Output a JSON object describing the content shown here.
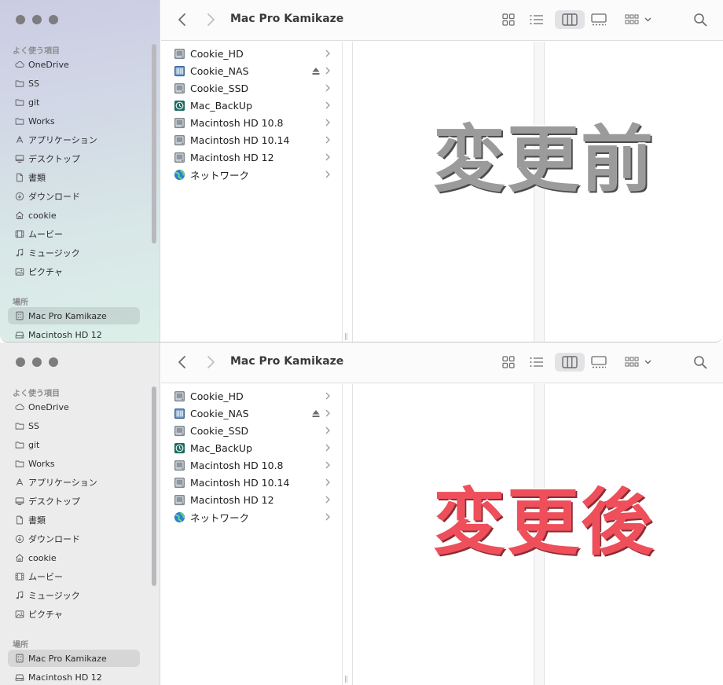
{
  "window_title": "Mac Pro Kamikaze",
  "sidebar": {
    "favorites_header": "よく使う項目",
    "locations_header": "場所",
    "favorites": [
      {
        "label": "OneDrive",
        "icon": "cloud-icon"
      },
      {
        "label": "SS",
        "icon": "folder-icon"
      },
      {
        "label": "git",
        "icon": "folder-icon"
      },
      {
        "label": "Works",
        "icon": "folder-icon"
      },
      {
        "label": "アプリケーション",
        "icon": "applications-icon"
      },
      {
        "label": "デスクトップ",
        "icon": "desktop-icon"
      },
      {
        "label": "書類",
        "icon": "document-icon"
      },
      {
        "label": "ダウンロード",
        "icon": "download-icon"
      },
      {
        "label": "cookie",
        "icon": "home-icon"
      },
      {
        "label": "ムービー",
        "icon": "film-icon"
      },
      {
        "label": "ミュージック",
        "icon": "music-icon"
      },
      {
        "label": "ピクチャ",
        "icon": "photo-icon"
      }
    ],
    "locations": [
      {
        "label": "Mac Pro Kamikaze",
        "icon": "computer-icon",
        "selected": true
      },
      {
        "label": "Macintosh HD 12",
        "icon": "drive-icon"
      }
    ]
  },
  "column1": [
    {
      "label": "Cookie_HD",
      "icon": "hard-drive-icon"
    },
    {
      "label": "Cookie_NAS",
      "icon": "nas-drive-icon",
      "ejectable": true
    },
    {
      "label": "Cookie_SSD",
      "icon": "hard-drive-icon"
    },
    {
      "label": "Mac_BackUp",
      "icon": "time-machine-icon"
    },
    {
      "label": "Macintosh HD 10.8",
      "icon": "hard-drive-icon"
    },
    {
      "label": "Macintosh HD 10.14",
      "icon": "hard-drive-icon"
    },
    {
      "label": "Macintosh HD 12",
      "icon": "hard-drive-icon"
    },
    {
      "label": "ネットワーク",
      "icon": "network-globe-icon"
    }
  ],
  "overlay": {
    "before_label": "変更前",
    "after_label": "変更後",
    "before_color": "#9b9b9b",
    "after_color": "#ee4f5b"
  },
  "colors": {
    "sidebar_before": "#d2d9e6",
    "sidebar_after": "#ececec",
    "traffic_light": "#7d7d7f"
  }
}
